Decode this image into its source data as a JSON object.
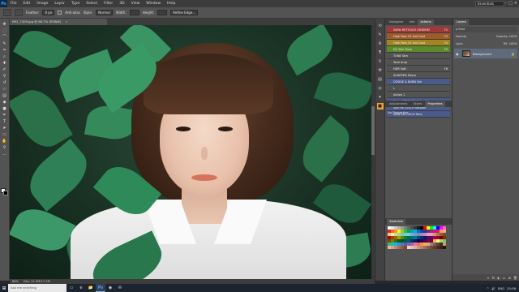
{
  "app": {
    "logo": "Ps",
    "menu": [
      "File",
      "Edit",
      "Image",
      "Layer",
      "Type",
      "Select",
      "Filter",
      "3D",
      "View",
      "Window",
      "Help"
    ],
    "workspace": "Essentials",
    "window_controls": [
      "–",
      "□",
      "×"
    ]
  },
  "options_bar": {
    "feather_label": "Feather:",
    "feather_value": "0 px",
    "antialias_label": "Anti-alias",
    "style_label": "Style:",
    "style_value": "Normal",
    "width_label": "Width:",
    "height_label": "Height:",
    "refine_label": "Refine Edge..."
  },
  "document": {
    "tab_title": "IMG_7409.jpg @ 66.7% (RGB/8)",
    "close": "×"
  },
  "status": {
    "zoom": "66%",
    "doc_info": "Doc: 21.5M/17.2M"
  },
  "actions_panel": {
    "tabs": [
      "Navigator",
      "Info",
      "Actions"
    ],
    "active_tab": "Actions",
    "items": [
      {
        "label": "Selfie RETOUCH CMIGRIM",
        "key": "F2",
        "color": "#a03838"
      },
      {
        "label": "High Pass V2 Hot Gold",
        "key": "F3",
        "color": "#a05a2a"
      },
      {
        "label": "High Pass V2 Hot Gold",
        "key": "F4",
        "color": "#a0861e"
      },
      {
        "label": "DC Skin Tone",
        "key": "F5",
        "color": "#5c8a2a"
      },
      {
        "label": "TONE Skin",
        "key": "",
        "color": "#535353"
      },
      {
        "label": "Tone drop",
        "key": "",
        "color": "#535353"
      },
      {
        "label": "HDR Soft",
        "key": "F6",
        "color": "#535353"
      },
      {
        "label": "SHARPEN Sharp",
        "key": "",
        "color": "#535353"
      },
      {
        "label": "DODGE & BURN Set",
        "key": "",
        "color": "#4a5a8a"
      },
      {
        "label": "L",
        "key": "",
        "color": "#535353"
      },
      {
        "label": "Action 1",
        "key": "",
        "color": "#535353"
      },
      {
        "label": "Color RETOUCH Colourful",
        "key": "",
        "color": "#4a5a8a"
      },
      {
        "label": "Skin RETOUCH Smooth",
        "key": "",
        "color": "#4a5a8a"
      },
      {
        "label": "SKIN RETOUCH Tone",
        "key": "",
        "color": "#4a5a8a"
      }
    ]
  },
  "properties_panel": {
    "tabs": [
      "Adjustments",
      "Styles",
      "Properties"
    ],
    "active_tab": "Properties",
    "title": "No Properties"
  },
  "swatches_panel": {
    "tabs": [
      "Swatches"
    ],
    "colors": [
      "#ffffff",
      "#e6e6e6",
      "#cccccc",
      "#b3b3b3",
      "#999999",
      "#808080",
      "#666666",
      "#4d4d4d",
      "#333333",
      "#1a1a1a",
      "#000000",
      "#ff0000",
      "#ffff00",
      "#00ff00",
      "#00ffff",
      "#0000ff",
      "#ff00ff",
      "#ff66cc",
      "#ed1c24",
      "#f26522",
      "#f7941d",
      "#fff200",
      "#8dc63f",
      "#39b54a",
      "#00a651",
      "#00a99d",
      "#00aeef",
      "#0072bc",
      "#0054a6",
      "#2e3192",
      "#662d91",
      "#92278f",
      "#ec008c",
      "#ed145b",
      "#f69679",
      "#f9ad81",
      "#fdc689",
      "#fff799",
      "#c4df9b",
      "#a3d39c",
      "#82ca9c",
      "#7accc8",
      "#6dcff6",
      "#7da7d9",
      "#8393ca",
      "#8781bd",
      "#a187be",
      "#bd8cbf",
      "#f49ac1",
      "#f5989d",
      "#c69c6d",
      "#a67c52",
      "#8c6239",
      "#754c24",
      "#9e0b0f",
      "#a0410d",
      "#a36209",
      "#aba000",
      "#598527",
      "#197b30",
      "#007236",
      "#00746b",
      "#0076a3",
      "#004a80",
      "#003471",
      "#1b1464",
      "#440e62",
      "#630460",
      "#9e005d",
      "#9e0039",
      "#790000",
      "#7b2e00",
      "#7d4900",
      "#827b00",
      "#406618",
      "#005e20",
      "#005826",
      "#005952",
      "#005b7f",
      "#003663",
      "#002157",
      "#0d004c",
      "#32004b",
      "#4b0049",
      "#7b0046",
      "#7a0026",
      "#fbaf5d",
      "#fff568",
      "#acd373",
      "#7cc576",
      "#3bb878",
      "#1abbb4",
      "#00bff3",
      "#448ccb",
      "#5674b9",
      "#605ca8",
      "#8560a8",
      "#a864a8",
      "#f06eaa",
      "#f26c4f",
      "#f68e56",
      "#fbaf5d",
      "#c7b299",
      "#998675",
      "#736357",
      "#534741",
      "#362f2d",
      "#c69c6d",
      "#e8b5a4",
      "#d9a08b",
      "#c2866f",
      "#a86f59",
      "#8e5a46",
      "#784633",
      "#f2d3c4",
      "#e8c0aa",
      "#deaf95",
      "#c89a82",
      "#b8846c",
      "#a26e56",
      "#8b5a45",
      "#764837",
      "#63382b",
      "#502a20",
      "#3e1e17",
      "#2c130e"
    ]
  },
  "layers_panel": {
    "tabs": [
      "Layers"
    ],
    "kind_label": "ρ Kind",
    "blend_mode": "Normal",
    "opacity_label": "Opacity: 100%",
    "lock_label": "Lock:",
    "fill_label": "Fill: 100%",
    "layers": [
      {
        "name": "Background",
        "locked": true
      }
    ],
    "footer_icons": [
      "∞",
      "fx",
      "◐",
      "▭",
      "⊞",
      "🗑"
    ]
  },
  "taskbar": {
    "start": "⊞",
    "search_placeholder": "Ask me anything",
    "apps": [
      "▭",
      "e",
      "📁",
      "Ps",
      "◉",
      "✉"
    ],
    "active_app": "Ps",
    "time": "20:08",
    "tray": [
      "^",
      "🔊",
      "ENG"
    ]
  }
}
